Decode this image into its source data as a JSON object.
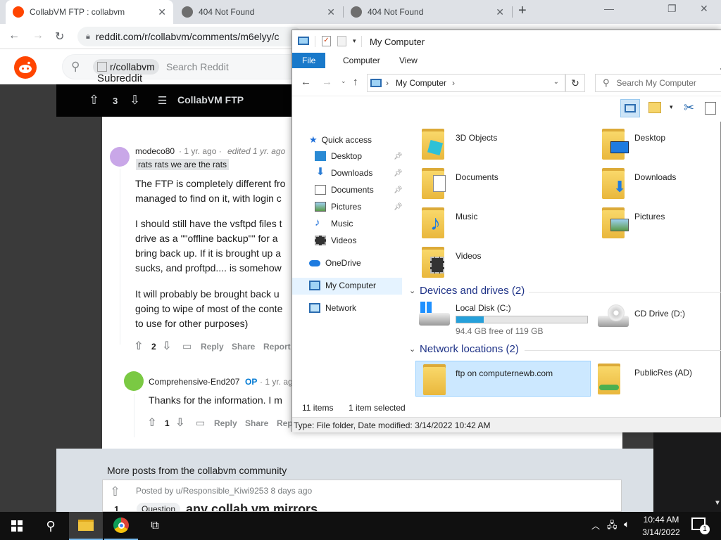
{
  "browser": {
    "tabs": [
      {
        "title": "CollabVM FTP : collabvm"
      },
      {
        "title": "404 Not Found"
      },
      {
        "title": "404 Not Found"
      }
    ],
    "url": "reddit.com/r/collabvm/comments/m6elyy/c"
  },
  "reddit": {
    "subreddit_chip": "r/collabvm",
    "search_placeholder": "Search Reddit",
    "subreddit_label": "Subreddit",
    "post": {
      "votes": "3",
      "title": "CollabVM FTP"
    },
    "comment1": {
      "author": "modeco80",
      "time": "· 1 yr. ago ·",
      "edited": "edited 1 yr. ago",
      "flair": "rats rats we are the rats",
      "lines": [
        "The FTP is completely different fro",
        "managed to find on it, with login c",
        "I should still have the vsftpd files t",
        "drive as a \"\"offline backup\"\" for a",
        "bring back up. If it is brought up a",
        "sucks, and proftpd.... is somehow",
        "It will probably be brought back u",
        "going to wipe of most of the conte",
        "to use for other purposes)"
      ],
      "votes": "2",
      "reply": "Reply",
      "share": "Share",
      "report": "Report"
    },
    "comment2": {
      "author": "Comprehensive-End207",
      "op": "OP",
      "time": "· 1 yr. ag",
      "text": "Thanks for the information. I m",
      "votes": "1",
      "reply": "Reply",
      "share": "Share",
      "report": "Rep"
    },
    "more_header": "More posts from the collabvm community",
    "more_post": {
      "posted_by": "Posted by u/Responsible_Kiwi9253 8 days ago",
      "votes": "1",
      "flair": "Question",
      "title": "any collab vm mirrors"
    }
  },
  "explorer": {
    "title": "My Computer",
    "ribbon_tabs": [
      "File",
      "Computer",
      "View"
    ],
    "address": "My Computer",
    "search_placeholder": "Search My Computer",
    "nav": {
      "quick_access": "Quick access",
      "desktop": "Desktop",
      "downloads": "Downloads",
      "documents": "Documents",
      "pictures": "Pictures",
      "music": "Music",
      "videos": "Videos",
      "onedrive": "OneDrive",
      "mycomputer": "My Computer",
      "network": "Network"
    },
    "folders": {
      "objects3d": "3D Objects",
      "desktop": "Desktop",
      "documents": "Documents",
      "downloads": "Downloads",
      "music": "Music",
      "pictures": "Pictures",
      "videos": "Videos"
    },
    "devices_header": "Devices and drives (2)",
    "local_disk": {
      "name": "Local Disk (C:)",
      "free": "94.4 GB free of 119 GB",
      "used_fraction": 0.21
    },
    "cd_drive": "CD Drive (D:)",
    "network_header": "Network locations (2)",
    "net_ftp": "ftp on computernewb.com",
    "net_public": "PublicRes (AD)",
    "status_items": "11 items",
    "status_selected": "1 item selected",
    "details": "Type: File folder, Date modified: 3/14/2022 10:42 AM"
  },
  "taskbar": {
    "time": "10:44 AM",
    "date": "3/14/2022",
    "notif_count": "1"
  }
}
